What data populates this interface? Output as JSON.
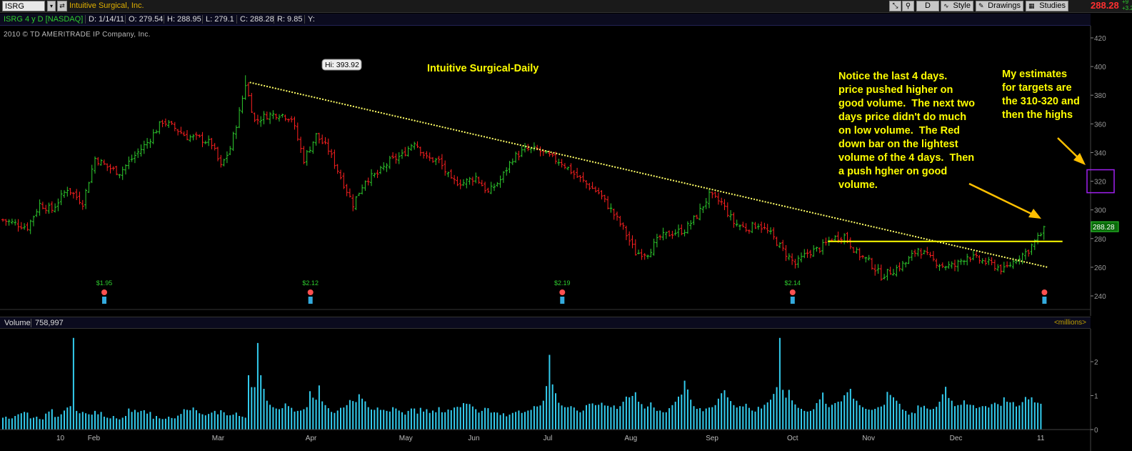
{
  "toolbar": {
    "symbol": "ISRG",
    "company": "Intuitive Surgical, Inc.",
    "aggregation_label": "D",
    "style_label": "Style",
    "drawings_label": "Drawings",
    "studies_label": "Studies",
    "last_price": "288.28",
    "net_change_top": "+9",
    "net_change_bottom": "+3.29"
  },
  "info_bar": {
    "title": "ISRG 4 y D [NASDAQ]",
    "date": "D: 1/14/11",
    "open": "O: 279.54",
    "high": "H: 288.95",
    "low": "L: 279.1",
    "close": "C: 288.28",
    "range": "R: 9.85",
    "y": "Y:"
  },
  "copyright": "2010 © TD AMERITRADE IP Company, Inc.",
  "chart_title": "Intuitive Surgical-Daily",
  "hi_bubble": "Hi: 393.92",
  "annotation_1": "Notice the last 4 days.\nprice pushed higher on\ngood volume.  The next two\ndays price didn't do much\non low volume.  The Red\ndown bar on the lightest\nvolume of the 4 days.  Then\na push hgher on good\nvolume.",
  "annotation_2": "My estimates\nfor targets are\nthe 310-320 and\nthen the highs",
  "dividends": [
    "$1.95",
    "$2.12",
    "$2.19",
    "$2.14"
  ],
  "volume_bar": {
    "label": "Volume",
    "value": "758,997",
    "units": "<millions>"
  },
  "colors": {
    "up_bar": "#2ecc2e",
    "down_bar": "#ff2020",
    "volume": "#33ccee",
    "annotation": "#ffff00",
    "trendline": "#ffff66",
    "target_box": "#a020f0"
  },
  "chart_data": [
    {
      "type": "candlestick-ohlc",
      "title": "Intuitive Surgical-Daily",
      "x_ticks": [
        "10",
        "Feb",
        "Mar",
        "Apr",
        "May",
        "Jun",
        "Jul",
        "Aug",
        "Sep",
        "Oct",
        "Nov",
        "Dec",
        "11"
      ],
      "y_ticks": [
        240,
        260,
        280,
        300,
        320,
        340,
        360,
        380,
        400,
        420
      ],
      "ylim": [
        230,
        428
      ],
      "grid": false,
      "last_price": 288.28,
      "last_ohlc": {
        "date": "1/14/11",
        "open": 279.54,
        "high": 288.95,
        "low": 279.1,
        "close": 288.28
      },
      "high_marker": {
        "label": "Hi",
        "value": 393.92
      },
      "price_path": [
        [
          0,
          293
        ],
        [
          8,
          288
        ],
        [
          12,
          304
        ],
        [
          16,
          300
        ],
        [
          21,
          315
        ],
        [
          26,
          305
        ],
        [
          30,
          336
        ],
        [
          34,
          330
        ],
        [
          38,
          326
        ],
        [
          43,
          338
        ],
        [
          47,
          347
        ],
        [
          52,
          362
        ],
        [
          56,
          357
        ],
        [
          60,
          351
        ],
        [
          64,
          350
        ],
        [
          68,
          346
        ],
        [
          71,
          330
        ],
        [
          74,
          343
        ],
        [
          77,
          368
        ],
        [
          79,
          388
        ],
        [
          82,
          362
        ],
        [
          86,
          366
        ],
        [
          90,
          367
        ],
        [
          94,
          364
        ],
        [
          98,
          335
        ],
        [
          102,
          352
        ],
        [
          106,
          342
        ],
        [
          110,
          323
        ],
        [
          114,
          304
        ],
        [
          118,
          321
        ],
        [
          122,
          325
        ],
        [
          126,
          334
        ],
        [
          130,
          338
        ],
        [
          134,
          348
        ],
        [
          138,
          336
        ],
        [
          142,
          334
        ],
        [
          146,
          320
        ],
        [
          150,
          319
        ],
        [
          154,
          323
        ],
        [
          158,
          312
        ],
        [
          162,
          321
        ],
        [
          166,
          336
        ],
        [
          170,
          342
        ],
        [
          174,
          342
        ],
        [
          178,
          337
        ],
        [
          182,
          333
        ],
        [
          186,
          325
        ],
        [
          190,
          318
        ],
        [
          194,
          312
        ],
        [
          198,
          300
        ],
        [
          202,
          287
        ],
        [
          206,
          270
        ],
        [
          210,
          270
        ],
        [
          214,
          281
        ],
        [
          218,
          284
        ],
        [
          222,
          286
        ],
        [
          226,
          296
        ],
        [
          230,
          310
        ],
        [
          234,
          305
        ],
        [
          238,
          291
        ],
        [
          242,
          287
        ],
        [
          246,
          290
        ],
        [
          250,
          283
        ],
        [
          254,
          272
        ],
        [
          258,
          262
        ],
        [
          262,
          270
        ],
        [
          266,
          273
        ],
        [
          270,
          280
        ],
        [
          274,
          282
        ],
        [
          278,
          270
        ],
        [
          282,
          264
        ],
        [
          286,
          254
        ],
        [
          290,
          258
        ],
        [
          294,
          263
        ],
        [
          298,
          273
        ],
        [
          302,
          266
        ],
        [
          306,
          261
        ],
        [
          310,
          261
        ],
        [
          314,
          268
        ],
        [
          318,
          265
        ],
        [
          322,
          262
        ],
        [
          326,
          258
        ],
        [
          330,
          266
        ],
        [
          334,
          272
        ],
        [
          336,
          278
        ],
        [
          338,
          283
        ],
        [
          339,
          288.28
        ]
      ],
      "trendline": {
        "from": [
          79,
          393.92
        ],
        "to": [
          339,
          262
        ],
        "style": "dotted"
      },
      "horizontal_line": {
        "value": 278,
        "from": 254,
        "to": 339
      },
      "target_zone": [
        312,
        328
      ],
      "dividends": [
        {
          "index": 30,
          "label": "$1.95"
        },
        {
          "index": 99,
          "label": "$2.12"
        },
        {
          "index": 181,
          "label": "$2.19"
        },
        {
          "index": 256,
          "label": "$2.14"
        },
        {
          "index": 338,
          "label": ""
        }
      ]
    },
    {
      "type": "bar",
      "title": "Volume",
      "ylabel": "<millions>",
      "y_ticks": [
        0,
        1,
        2
      ],
      "ylim": [
        0,
        2.9
      ],
      "values": [
        0.35,
        0.38,
        0.32,
        0.33,
        0.4,
        0.45,
        0.48,
        0.52,
        0.5,
        0.33,
        0.35,
        0.38,
        0.31,
        0.3,
        0.47,
        0.53,
        0.6,
        0.37,
        0.38,
        0.45,
        0.56,
        0.65,
        0.69,
        2.7,
        0.55,
        0.48,
        0.52,
        0.48,
        0.45,
        0.44,
        0.55,
        0.45,
        0.52,
        0.38,
        0.35,
        0.33,
        0.4,
        0.33,
        0.3,
        0.35,
        0.4,
        0.62,
        0.52,
        0.58,
        0.51,
        0.55,
        0.57,
        0.47,
        0.52,
        0.32,
        0.4,
        0.33,
        0.31,
        0.32,
        0.38,
        0.34,
        0.33,
        0.41,
        0.46,
        0.6,
        0.58,
        0.57,
        0.65,
        0.57,
        0.48,
        0.45,
        0.42,
        0.46,
        0.5,
        0.55,
        0.45,
        0.57,
        0.51,
        0.42,
        0.42,
        0.44,
        0.5,
        0.4,
        0.38,
        0.35,
        1.6,
        1.25,
        1.25,
        2.55,
        1.6,
        1.2,
        0.85,
        0.73,
        0.66,
        0.62,
        0.6,
        0.63,
        0.77,
        0.69,
        0.64,
        0.53,
        0.55,
        0.56,
        0.6,
        0.66,
        1.13,
        0.94,
        0.88,
        1.3,
        0.83,
        0.72,
        0.63,
        0.52,
        0.49,
        0.56,
        0.64,
        0.65,
        0.72,
        0.87,
        0.84,
        0.81,
        1.04,
        0.91,
        0.83,
        0.66,
        0.59,
        0.58,
        0.65,
        0.58,
        0.58,
        0.55,
        0.53,
        0.66,
        0.62,
        0.56,
        0.51,
        0.44,
        0.55,
        0.62,
        0.62,
        0.47,
        0.64,
        0.53,
        0.6,
        0.49,
        0.56,
        0.51,
        0.66,
        0.51,
        0.51,
        0.59,
        0.57,
        0.65,
        0.67,
        0.66,
        0.78,
        0.76,
        0.75,
        0.68,
        0.6,
        0.5,
        0.55,
        0.64,
        0.63,
        0.5,
        0.51,
        0.5,
        0.43,
        0.48,
        0.39,
        0.44,
        0.49,
        0.52,
        0.56,
        0.49,
        0.52,
        0.56,
        0.58,
        0.69,
        0.68,
        0.71,
        0.85,
        1.28,
        2.2,
        1.33,
        1.07,
        0.79,
        0.71,
        0.66,
        0.66,
        0.69,
        0.65,
        0.56,
        0.51,
        0.56,
        0.72,
        0.76,
        0.77,
        0.72,
        0.73,
        0.79,
        0.71,
        0.7,
        0.66,
        0.71,
        0.61,
        0.69,
        0.82,
        0.97,
        0.95,
        0.99,
        1.1,
        0.82,
        0.75,
        0.62,
        0.68,
        0.8,
        0.65,
        0.55,
        0.56,
        0.51,
        0.51,
        0.63,
        0.72,
        0.82,
        0.97,
        1.03,
        1.44,
        1.18,
        0.88,
        0.69,
        0.61,
        0.63,
        0.54,
        0.62,
        0.65,
        0.66,
        0.72,
        0.91,
        1.07,
        1.16,
        0.95,
        0.84,
        0.72,
        0.65,
        0.69,
        0.68,
        0.76,
        0.64,
        0.56,
        0.53,
        0.67,
        0.62,
        0.73,
        0.8,
        0.88,
        1.05,
        1.25,
        2.7,
        1.17,
        0.94,
        1.17,
        0.86,
        0.74,
        0.64,
        0.61,
        0.55,
        0.53,
        0.55,
        0.6,
        0.78,
        0.89,
        1.09,
        0.76,
        0.66,
        0.73,
        0.78,
        0.82,
        0.83,
        1.01,
        1.1,
        1.2,
        0.91,
        0.85,
        0.72,
        0.66,
        0.61,
        0.59,
        0.58,
        0.61,
        0.66,
        0.68,
        0.73,
        1.11,
        1.02,
        0.95,
        0.85,
        0.76,
        0.59,
        0.55,
        0.44,
        0.5,
        0.48,
        0.71,
        0.66,
        0.7,
        0.62,
        0.59,
        0.61,
        0.67,
        0.82,
        1.04,
        1.26,
        0.93,
        0.85,
        0.69,
        0.72,
        0.73,
        0.86,
        0.74,
        0.73,
        0.72,
        0.63,
        0.66,
        0.69,
        0.69,
        0.65,
        0.75,
        0.79,
        0.75,
        0.7,
        0.95,
        0.82,
        0.8,
        0.81,
        0.68,
        0.71,
        0.81,
        0.96,
        0.89,
        0.95,
        0.8,
        0.79,
        0.76
      ],
      "last_value": 758997
    }
  ]
}
